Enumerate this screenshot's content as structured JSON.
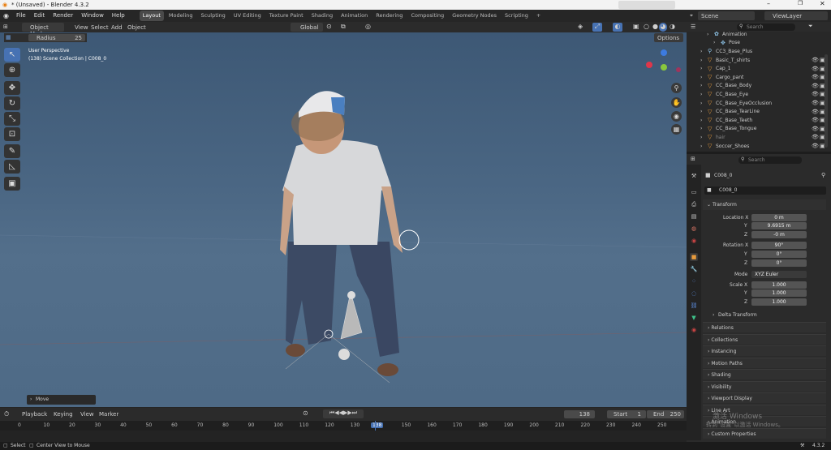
{
  "window": {
    "title": "* (Unsaved) - Blender 4.3.2"
  },
  "menu": [
    "File",
    "Edit",
    "Render",
    "Window",
    "Help"
  ],
  "workspaces": [
    "Layout",
    "Modeling",
    "Sculpting",
    "UV Editing",
    "Texture Paint",
    "Shading",
    "Animation",
    "Rendering",
    "Compositing",
    "Geometry Nodes",
    "Scripting"
  ],
  "top_right": {
    "scene": "Scene",
    "view_layer": "ViewLayer"
  },
  "viewport": {
    "mode": "Object Mode",
    "menus": [
      "View",
      "Select",
      "Add",
      "Object"
    ],
    "transform_orientation": "Global",
    "options": "Options",
    "radius_label": "Radius",
    "radius_value": "25",
    "overlay_line1": "User Perspective",
    "overlay_line2": "(138) Scene Collection | C008_0",
    "last_op": "Move"
  },
  "timeline": {
    "menus": [
      "Playback",
      "Keying",
      "View",
      "Marker"
    ],
    "current_frame": "138",
    "start_label": "Start",
    "start": "1",
    "end_label": "End",
    "end": "250",
    "ticks": [
      "0",
      "10",
      "20",
      "30",
      "40",
      "50",
      "60",
      "70",
      "80",
      "90",
      "100",
      "110",
      "120",
      "130",
      "138",
      "150",
      "160",
      "170",
      "180",
      "190",
      "200",
      "210",
      "220",
      "230",
      "240",
      "250"
    ],
    "current_fraction": 0.552
  },
  "statusbar": {
    "select": "Select",
    "center": "Center View to Mouse",
    "version": "4.3.2"
  },
  "outliner": {
    "search_placeholder": "Search",
    "items": [
      "Animation",
      "Pose",
      "CC3_Base_Plus",
      "Basic_T_shirts",
      "Cap_1",
      "Cargo_pant",
      "CC_Base_Body",
      "CC_Base_Eye",
      "CC_Base_EyeOcclusion",
      "CC_Base_TearLine",
      "CC_Base_Teeth",
      "CC_Base_Tongue",
      "hair",
      "Soccer_Shoes"
    ]
  },
  "properties": {
    "search_placeholder": "Search",
    "object_name": "C008_0",
    "data_name": "C008_0",
    "transform": "Transform",
    "location_label": "Location X",
    "location": [
      "0 m",
      "9.6915 m",
      "-0 m"
    ],
    "rotation_label": "Rotation X",
    "rotation": [
      "90°",
      "0°",
      "0°"
    ],
    "mode_label": "Mode",
    "mode_value": "XYZ Euler",
    "scale_label": "Scale X",
    "scale": [
      "1.000",
      "1.000",
      "1.000"
    ],
    "axis_y": "Y",
    "axis_z": "Z",
    "delta": "Delta Transform",
    "sections": [
      "Relations",
      "Collections",
      "Instancing",
      "Motion Paths",
      "Shading",
      "Visibility",
      "Viewport Display",
      "Line Art",
      "Animation",
      "Custom Properties"
    ]
  },
  "watermark": {
    "line1": "激活 Windows",
    "line2": "转到\"设置\"以激活 Windows。"
  },
  "colors": {
    "accent": "#4772b3",
    "header": "#2b2b2b",
    "panel": "#282828"
  }
}
